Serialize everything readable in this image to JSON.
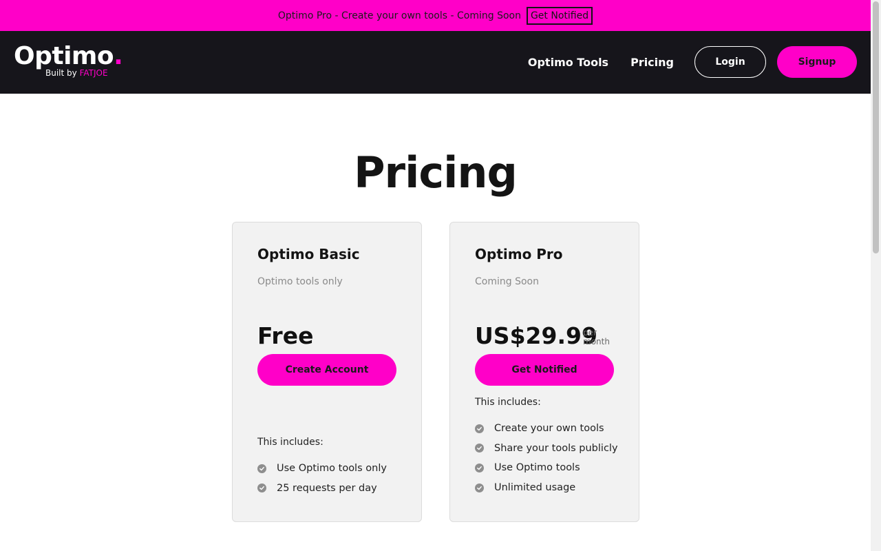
{
  "announcement": {
    "text": "Optimo Pro - Create your own tools - Coming Soon",
    "button": "Get Notified"
  },
  "header": {
    "logo": "Optimo",
    "logo_dot": ".",
    "built_by": "Built by",
    "built_by_brand": "FATJOE",
    "nav": {
      "tools": "Optimo Tools",
      "pricing": "Pricing",
      "login": "Login",
      "signup": "Signup"
    }
  },
  "page": {
    "title": "Pricing"
  },
  "plans": [
    {
      "name": "Optimo Basic",
      "subtitle": "Optimo tools only",
      "price": "Free",
      "per": "",
      "cta": "Create Account",
      "includes_label": "This includes:",
      "features": [
        "Use Optimo tools only",
        "25 requests per day"
      ]
    },
    {
      "name": "Optimo Pro",
      "subtitle": "Coming Soon",
      "price": "US$29.99",
      "per_line1": "per",
      "per_line2": "month",
      "cta": "Get Notified",
      "includes_label": "This includes:",
      "features": [
        "Create your own tools",
        "Share your tools publicly",
        "Use Optimo tools",
        "Unlimited usage"
      ]
    }
  ],
  "colors": {
    "accent": "#ff00c8",
    "header_bg": "#16151b",
    "card_bg": "#f2f2f2"
  }
}
